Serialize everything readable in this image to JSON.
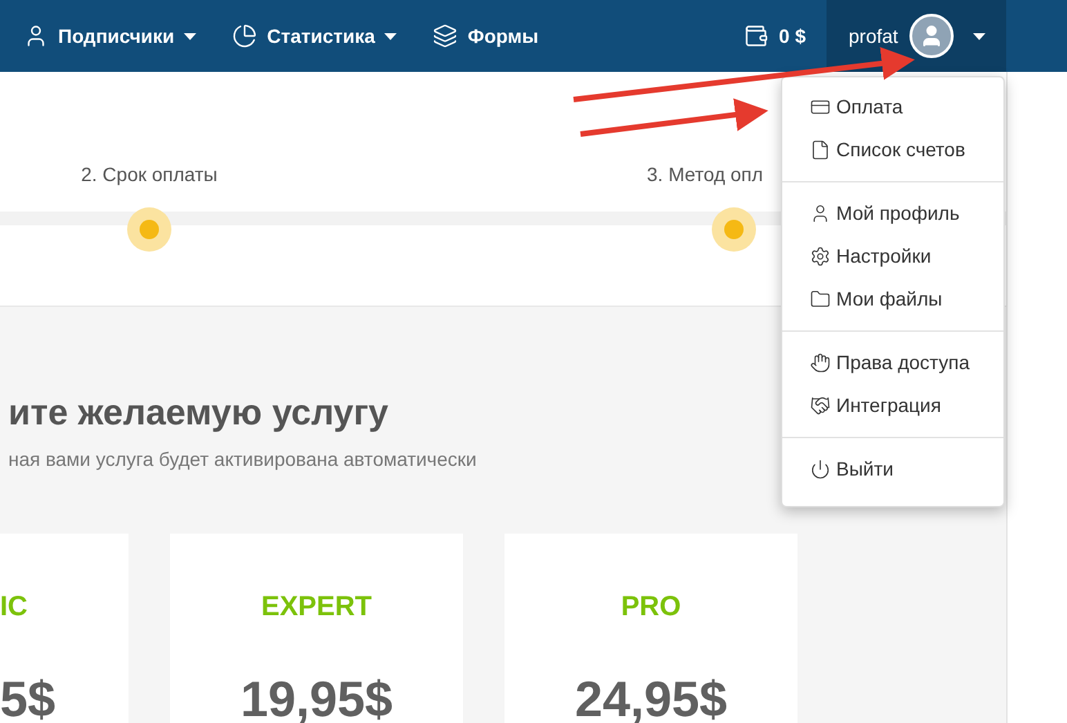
{
  "navbar": {
    "items": [
      {
        "label": "Подписчики",
        "has_menu": true
      },
      {
        "label": "Статистика",
        "has_menu": true
      },
      {
        "label": "Формы",
        "has_menu": false
      }
    ],
    "balance": "0 $",
    "user": {
      "name": "profat",
      "menu_open": true
    }
  },
  "stepper": {
    "steps": [
      {
        "label": "2. Срок оплаты"
      },
      {
        "label": "3. Метод опл"
      }
    ]
  },
  "heading": "ите желаемую услугу",
  "subheading": "ная вами услуга будет активирована автоматически",
  "plans": [
    {
      "name": "IC",
      "price": "5$"
    },
    {
      "name": "EXPERT",
      "price": "19,95$"
    },
    {
      "name": "PRO",
      "price": "24,95$"
    }
  ],
  "user_menu": {
    "groups": [
      [
        {
          "label": "Оплата"
        },
        {
          "label": "Список счетов"
        }
      ],
      [
        {
          "label": "Мой профиль"
        },
        {
          "label": "Настройки"
        },
        {
          "label": "Мои файлы"
        }
      ],
      [
        {
          "label": "Права доступа"
        },
        {
          "label": "Интеграция"
        }
      ],
      [
        {
          "label": "Выйти"
        }
      ]
    ]
  }
}
